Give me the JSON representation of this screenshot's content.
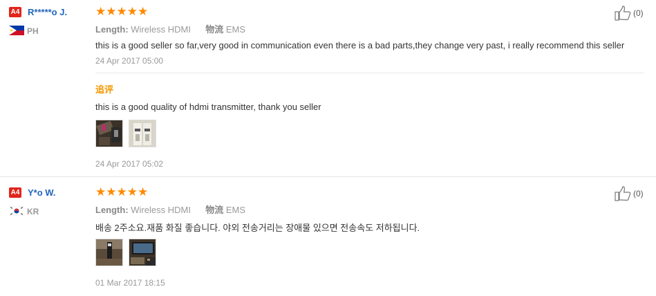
{
  "reviews": [
    {
      "badge": "A4",
      "username": "R*****o J.",
      "country": "PH",
      "stars": "★★★★★",
      "length_label": "Length:",
      "length_value": "Wireless HDMI",
      "shipping_label": "物流",
      "shipping_value": "EMS",
      "text": "this is a good seller so far,very good in communication even there is a bad parts,they change very past, i really recommend this seller",
      "date": "24 Apr 2017 05:00",
      "useful_count": "(0)",
      "followup": {
        "label": "追评",
        "text": "this is a good quality of hdmi transmitter, thank you seller",
        "date": "24 Apr 2017 05:02"
      }
    },
    {
      "badge": "A4",
      "username": "Y*o W.",
      "country": "KR",
      "stars": "★★★★★",
      "length_label": "Length:",
      "length_value": "Wireless HDMI",
      "shipping_label": "物流",
      "shipping_value": "EMS",
      "text": "배송 2주소요.재품 화질 좋습니다. 야외 전송거리는 장애물 있으면 전송속도 저하됩니다.",
      "date": "01 Mar 2017 18:15",
      "useful_count": "(0)"
    }
  ],
  "colors": {
    "star": "#ff8a00",
    "username": "#2266bb",
    "badge": "#e1251b",
    "followup_label": "#f39800"
  },
  "icons": [
    "thumbs-up-icon",
    "philippines-flag-icon",
    "south-korea-flag-icon"
  ]
}
